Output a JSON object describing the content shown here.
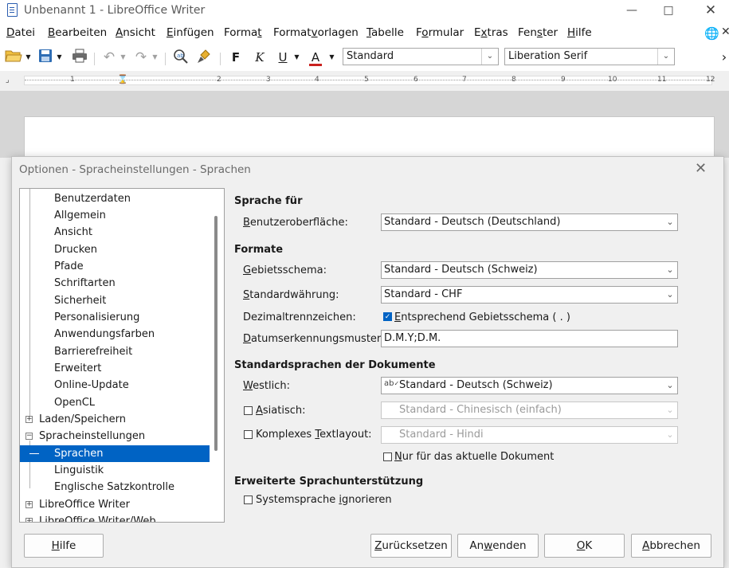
{
  "window": {
    "title": "Unbenannt 1 - LibreOffice Writer"
  },
  "menu": [
    {
      "pre": "",
      "u": "D",
      "post": "atei"
    },
    {
      "pre": "",
      "u": "B",
      "post": "earbeiten"
    },
    {
      "pre": "",
      "u": "A",
      "post": "nsicht"
    },
    {
      "pre": "",
      "u": "E",
      "post": "infügen"
    },
    {
      "pre": "Forma",
      "u": "t",
      "post": ""
    },
    {
      "pre": "Format",
      "u": "v",
      "post": "orlagen"
    },
    {
      "pre": "",
      "u": "T",
      "post": "abelle"
    },
    {
      "pre": "F",
      "u": "o",
      "post": "rmular"
    },
    {
      "pre": "E",
      "u": "x",
      "post": "tras"
    },
    {
      "pre": "Fen",
      "u": "s",
      "post": "ter"
    },
    {
      "pre": "",
      "u": "H",
      "post": "ilfe"
    }
  ],
  "toolbar": {
    "bold": "F",
    "italic": "K",
    "underline": "U",
    "fontcolor": "A",
    "paragraph_style": "Standard",
    "font_name": "Liberation Serif",
    "overflow": "›",
    "ruler_numbers": [
      "1",
      "2",
      "3",
      "4",
      "5",
      "6",
      "7",
      "8",
      "9",
      "10",
      "11",
      "12"
    ]
  },
  "dialog": {
    "title": "Optionen - Spracheinstellungen - Sprachen",
    "tree": {
      "children_libreoffice": [
        "Benutzerdaten",
        "Allgemein",
        "Ansicht",
        "Drucken",
        "Pfade",
        "Schriftarten",
        "Sicherheit",
        "Personalisierung",
        "Anwendungsfarben",
        "Barrierefreiheit",
        "Erweitert",
        "Online-Update",
        "OpenCL"
      ],
      "loading": "Laden/Speichern",
      "language_settings": "Spracheinstellungen",
      "languages": "Sprachen",
      "linguistics": "Linguistik",
      "english_check": "Englische Satzkontrolle",
      "writer": "LibreOffice Writer",
      "writer_web": "LibreOffice Writer/Web"
    },
    "section_language_for": "Sprache für",
    "ui_label": {
      "pre": "",
      "u": "B",
      "post": "enutzeroberfläche:"
    },
    "ui_value": "Standard - Deutsch (Deutschland)",
    "section_formats": "Formate",
    "locale_label": {
      "pre": "",
      "u": "G",
      "post": "ebietsschema:"
    },
    "locale_value": "Standard - Deutsch (Schweiz)",
    "currency_label": {
      "pre": "",
      "u": "S",
      "post": "tandardwährung:"
    },
    "currency_value": "Standard - CHF",
    "decimal_label": "Dezimaltrennzeichen:",
    "decimal_check_label": {
      "pre": "",
      "u": "E",
      "post": "ntsprechend Gebietsschema ( . )"
    },
    "date_label": {
      "pre": "",
      "u": "D",
      "post": "atumserkennungsmuster:"
    },
    "date_value": "D.M.Y;D.M.",
    "section_default_languages": "Standardsprachen der Dokumente",
    "western_label": {
      "pre": "",
      "u": "W",
      "post": "estlich:"
    },
    "western_value": "Standard - Deutsch (Schweiz)",
    "asian_label": {
      "pre": "",
      "u": "A",
      "post": "siatisch:"
    },
    "asian_value": "Standard - Chinesisch (einfach)",
    "ctl_label": {
      "pre": "Komplexes ",
      "u": "T",
      "post": "extlayout:"
    },
    "ctl_value": "Standard - Hindi",
    "current_doc_only": {
      "pre": "",
      "u": "N",
      "post": "ur für das aktuelle Dokument"
    },
    "section_extended": "Erweiterte Sprachunterstützung",
    "ignore_system_label": {
      "pre": "Systemsprache ",
      "u": "i",
      "post": "gnorieren"
    },
    "buttons": {
      "help": {
        "pre": "",
        "u": "H",
        "post": "ilfe"
      },
      "reset": {
        "pre": "",
        "u": "Z",
        "post": "urücksetzen"
      },
      "apply": {
        "pre": "An",
        "u": "w",
        "post": "enden"
      },
      "ok": {
        "pre": "",
        "u": "O",
        "post": "K"
      },
      "cancel": {
        "pre": "",
        "u": "A",
        "post": "bbrechen"
      }
    }
  },
  "colors": {
    "accent": "#0063c4",
    "font_color_bar": "#c9211e"
  }
}
